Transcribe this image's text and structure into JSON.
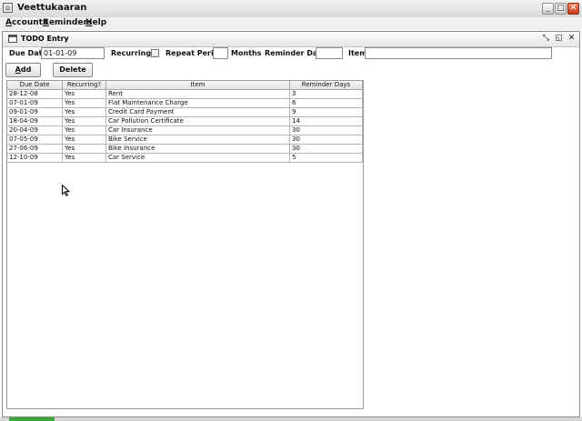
{
  "window": {
    "title": "Veettukaaran"
  },
  "menubar": {
    "items": [
      {
        "label": "Accounts",
        "mnemonic": "A",
        "rest": "ccounts"
      },
      {
        "label": "Reminders",
        "mnemonic": "R",
        "rest": "eminders"
      },
      {
        "label": "Help",
        "mnemonic": "H",
        "rest": "elp"
      }
    ]
  },
  "frame": {
    "title": "TODO Entry"
  },
  "form": {
    "due_date_label": "Due Date",
    "due_date_value": "01-01-09",
    "recurring_label": "Recurring?",
    "recurring_checked": false,
    "repeat_period_label": "Repeat Period",
    "repeat_period_value": "",
    "months_label": "Months",
    "reminder_days_label": "Reminder Days",
    "reminder_days_value": "",
    "item_label": "Item",
    "item_value": "",
    "add_button": {
      "mnemonic": "A",
      "rest": "dd"
    },
    "delete_button": "Delete"
  },
  "table": {
    "columns": [
      "Due Date",
      "Recurring?",
      "Item",
      "Reminder Days"
    ],
    "rows": [
      [
        "28-12-08",
        "Yes",
        "Rent",
        "3"
      ],
      [
        "07-01-09",
        "Yes",
        "Flat Maintenance Charge",
        "6"
      ],
      [
        "09-01-09",
        "Yes",
        "Credit Card Payment",
        "9"
      ],
      [
        "18-04-09",
        "Yes",
        "Car Pollution Certificate",
        "14"
      ],
      [
        "20-04-09",
        "Yes",
        "Car Insurance",
        "30"
      ],
      [
        "07-05-09",
        "Yes",
        "Bike Service",
        "30"
      ],
      [
        "27-06-09",
        "Yes",
        "Bike Insurance",
        "30"
      ],
      [
        "12-10-09",
        "Yes",
        "Car Service",
        "5"
      ]
    ]
  },
  "icons": {
    "app": "house-icon",
    "frame": "window-icon",
    "minimize": "minimize-icon",
    "maximize": "maximize-icon",
    "close": "close-icon"
  },
  "colors": {
    "close_button": "#c9391a",
    "taskbar": "#3ca53c"
  }
}
